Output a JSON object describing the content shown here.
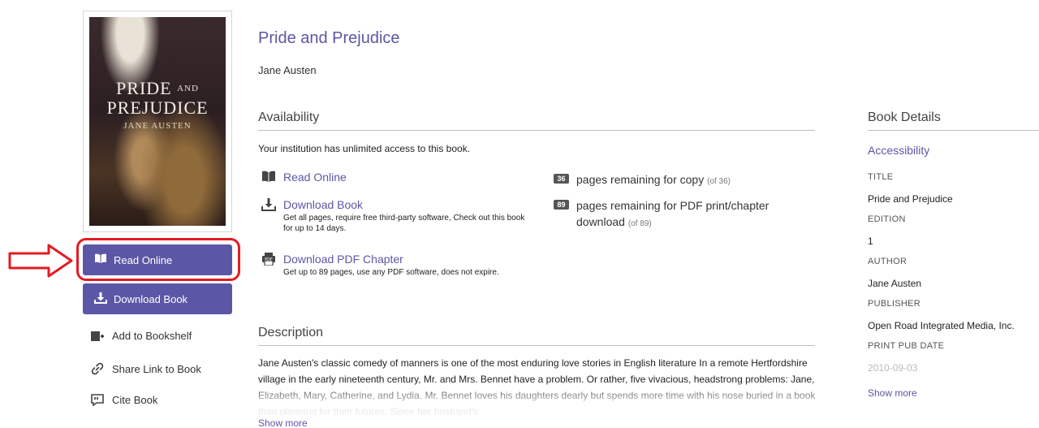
{
  "book": {
    "title": "Pride and Prejudice",
    "author": "Jane Austen",
    "cover": {
      "title_line1": "PRIDE",
      "title_and": "AND",
      "title_line2": "PREJUDICE",
      "author": "JANE AUSTEN"
    }
  },
  "actions": {
    "read_online": "Read Online",
    "download_book": "Download Book",
    "add_to_bookshelf": "Add to Bookshelf",
    "share_link": "Share Link to Book",
    "cite_book": "Cite Book"
  },
  "availability": {
    "heading": "Availability",
    "access_text": "Your institution has unlimited access to this book.",
    "options": [
      {
        "label": "Read Online",
        "icon": "open-book-icon",
        "note": ""
      },
      {
        "label": "Download Book",
        "icon": "download-icon",
        "note": "Get all pages, require free third-party software, Check out this book for up to 14 days."
      },
      {
        "label": "Download PDF Chapter",
        "icon": "pdf-icon",
        "note": "Get up to 89 pages, use any PDF software, does not expire."
      }
    ],
    "quotas": [
      {
        "count": "36",
        "text": "pages remaining for copy",
        "of": "(of 36)"
      },
      {
        "count": "89",
        "text": "pages remaining for PDF print/chapter download",
        "of": "(of 89)"
      }
    ]
  },
  "description": {
    "heading": "Description",
    "text": "Jane Austen's classic comedy of manners is one of the most enduring love stories in English literature In a remote Hertfordshire village in the early nineteenth century, Mr. and Mrs. Bennet have a problem. Or rather, five vivacious, headstrong problems: Jane, Elizabeth, Mary, Catherine, and Lydia. Mr. Bennet loves his daughters dearly but spends more time with his nose buried in a book than planning for their futures. Since her husband's",
    "show_more": "Show more"
  },
  "details": {
    "heading": "Book Details",
    "accessibility": "Accessibility",
    "fields": [
      {
        "label": "TITLE",
        "value": "Pride and Prejudice"
      },
      {
        "label": "EDITION",
        "value": "1"
      },
      {
        "label": "AUTHOR",
        "value": "Jane Austen"
      },
      {
        "label": "PUBLISHER",
        "value": "Open Road Integrated Media, Inc."
      },
      {
        "label": "PRINT PUB DATE",
        "value": "2010-09-03"
      }
    ],
    "show_more": "Show more"
  },
  "colors": {
    "accent": "#5b57a6",
    "highlight": "#e31b23",
    "badge": "#555555"
  }
}
